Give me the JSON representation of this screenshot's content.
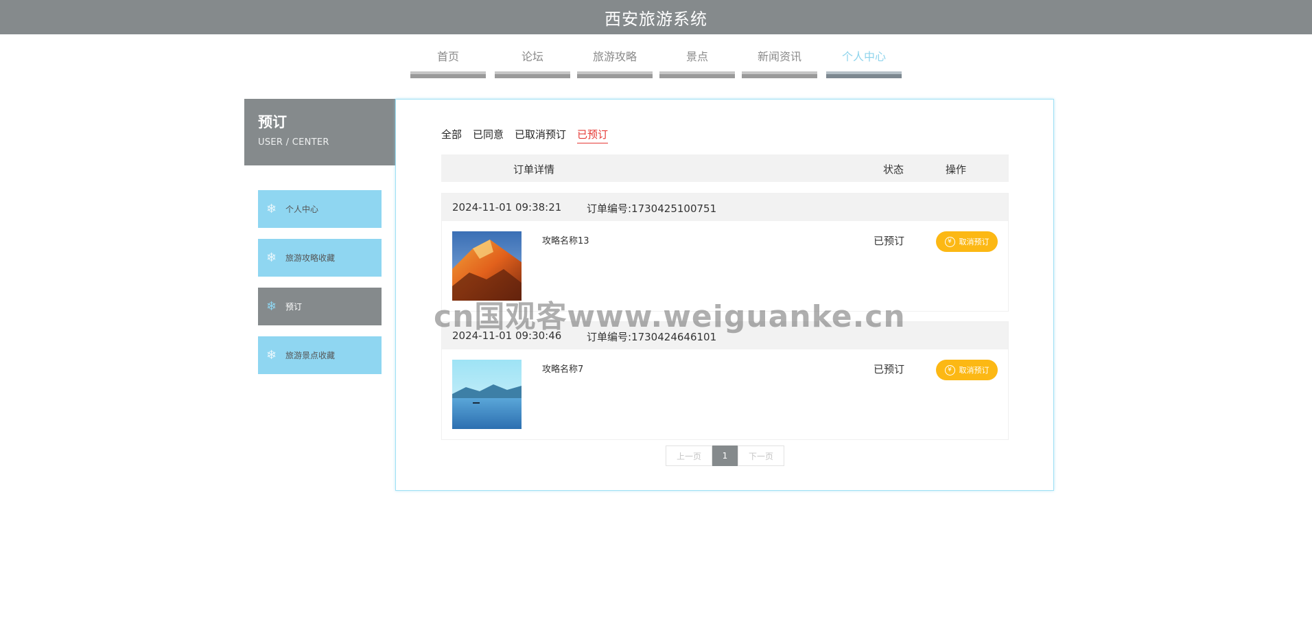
{
  "header": {
    "title": "西安旅游系统"
  },
  "nav": {
    "items": [
      {
        "label": "首页",
        "active": false
      },
      {
        "label": "论坛",
        "active": false
      },
      {
        "label": "旅游攻略",
        "active": false
      },
      {
        "label": "景点",
        "active": false
      },
      {
        "label": "新闻资讯",
        "active": false
      },
      {
        "label": "个人中心",
        "active": true
      }
    ]
  },
  "sidebar": {
    "title": "预订",
    "subtitle": "USER / CENTER",
    "items": [
      {
        "label": "个人中心",
        "active": false
      },
      {
        "label": "旅游攻略收藏",
        "active": false
      },
      {
        "label": "预订",
        "active": true
      },
      {
        "label": "旅游景点收藏",
        "active": false
      }
    ]
  },
  "tabs": [
    {
      "label": "全部",
      "active": false
    },
    {
      "label": "已同意",
      "active": false
    },
    {
      "label": "已取消预订",
      "active": false
    },
    {
      "label": "已预订",
      "active": true
    }
  ],
  "table": {
    "col_detail": "订单详情",
    "col_status": "状态",
    "col_action": "操作"
  },
  "orders": [
    {
      "date": "2024-11-01 09:38:21",
      "order_no": "订单编号:1730425100751",
      "name": "攻略名称13",
      "status": "已预订",
      "cancel_label": "取消预订",
      "thumb": "mountain-photo"
    },
    {
      "date": "2024-11-01 09:30:46",
      "order_no": "订单编号:1730424646101",
      "name": "攻略名称7",
      "status": "已预订",
      "cancel_label": "取消预订",
      "thumb": "lake-photo"
    }
  ],
  "pager": {
    "prev": "上一页",
    "page": "1",
    "next": "下一页"
  },
  "watermark": "cn国观客www.weiguanke.cn",
  "colors": {
    "header_bg": "#858a8c",
    "accent_blue": "#8fd6f1",
    "button_orange": "#fcb814",
    "active_tab_red": "#e53935"
  },
  "icons": {
    "sidebar_item": "snowflake-icon",
    "cancel_button": "yen-icon"
  }
}
